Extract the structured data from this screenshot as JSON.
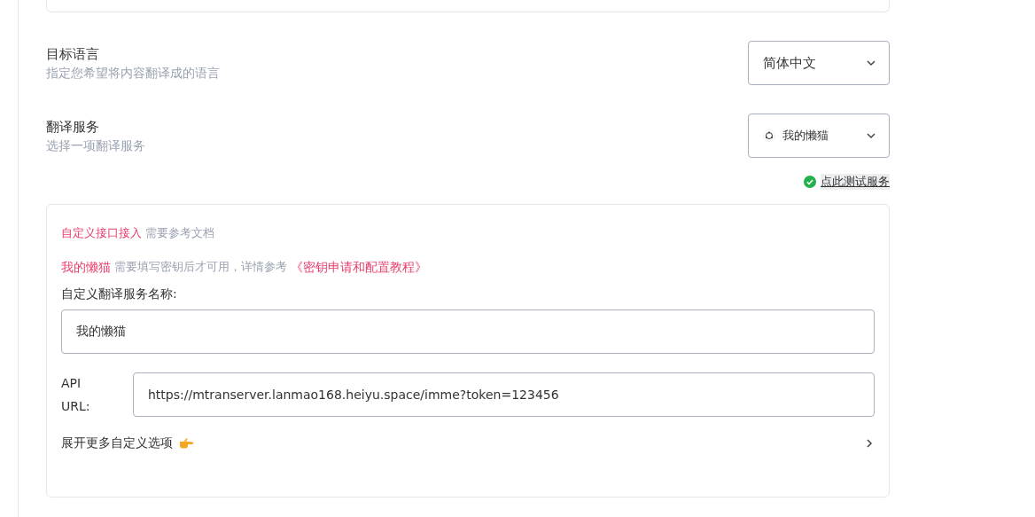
{
  "settings": [
    {
      "kind": "select",
      "title": "目标语言",
      "description": "指定您希望将内容翻译成的语言",
      "value": "简体中文",
      "has_icon": false
    },
    {
      "kind": "select",
      "title": "翻译服务",
      "description": "选择一项翻译服务",
      "value": "我的懒猫",
      "has_icon": true
    }
  ],
  "test_link": {
    "label": "点此测试服务",
    "ok": true
  },
  "custom_panel": {
    "type_label": "自定义接口接入",
    "type_note": "需要参考文档",
    "service_name": "我的懒猫",
    "service_note": "需要填写密钥后才可用，详情参考",
    "tutorial_link": "《密钥申请和配置教程》",
    "name_label": "自定义翻译服务名称:",
    "name_value": "我的懒猫",
    "url_label": "API URL:",
    "url_value": "https://mtranserver.lanmao168.heiyu.space/imme?token=123456",
    "more_options": {
      "label": "展开更多自定义选项",
      "expanded": false
    }
  }
}
